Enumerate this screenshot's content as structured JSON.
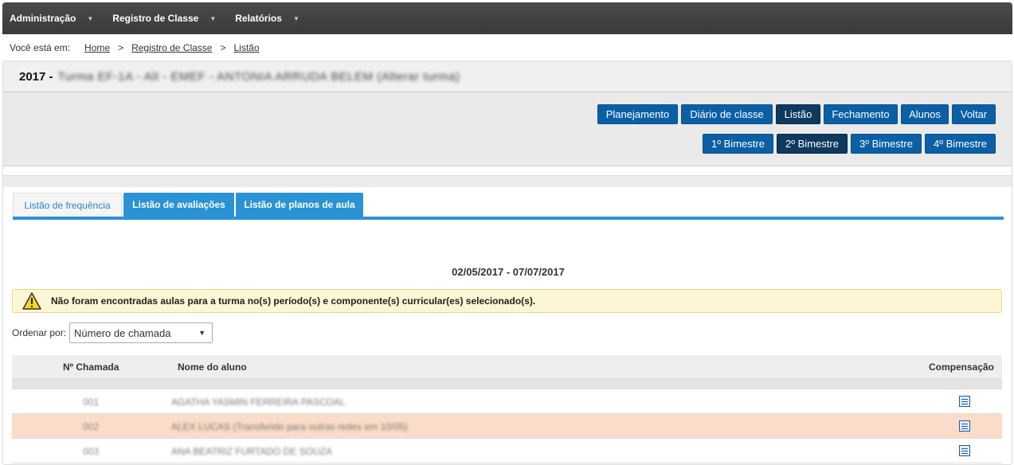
{
  "nav": {
    "items": [
      {
        "label": "Administração"
      },
      {
        "label": "Registro de Classe"
      },
      {
        "label": "Relatórios"
      }
    ]
  },
  "breadcrumb": {
    "prefix": "Você está em:",
    "items": [
      "Home",
      "Registro de Classe",
      "Listão"
    ],
    "separator": ">"
  },
  "header": {
    "year": "2017 -",
    "class_name": "Turma EF-1A - Alt - EMEF - ANTONIA ARRUDA BELEM (Alterar turma)"
  },
  "toolbar": {
    "buttons": [
      "Planejamento",
      "Diário de classe",
      "Listão",
      "Fechamento",
      "Alunos",
      "Voltar"
    ],
    "active_button": "Listão",
    "bimesters": [
      "1º Bimestre",
      "2º Bimestre",
      "3º Bimestre",
      "4º Bimestre"
    ],
    "active_bimester": "2º Bimestre"
  },
  "tabs": [
    "Listão de frequência",
    "Listão de avaliações",
    "Listão de planos de aula"
  ],
  "date_range": "02/05/2017 - 07/07/2017",
  "alert": {
    "icon": "warning-icon",
    "text": "Não foram encontradas aulas para a turma no(s) período(s) e componente(s) curricular(es) selecionado(s)."
  },
  "sort": {
    "label": "Ordenar por:",
    "selected": "Número de chamada",
    "arrow": "▼"
  },
  "table": {
    "headers": {
      "number": "Nº Chamada",
      "name": "Nome do aluno",
      "comp": "Compensação"
    },
    "rows": [
      {
        "number": "001",
        "name": "AGATHA YASMIN FERREIRA PASCOAL"
      },
      {
        "number": "002",
        "name": "ALEX LUCAS (Transferido para outras redes em 10/05)"
      },
      {
        "number": "003",
        "name": "ANA BEATRIZ FURTADO DE SOUZA"
      }
    ]
  },
  "colors": {
    "nav_bg": "#3f3f3f",
    "button_blue": "#0b5fa5",
    "active_dark": "#0d3a5e",
    "tab_blue": "#2a93d5",
    "alert_bg": "#fcf6d4",
    "highlight_row": "#fbdcc8"
  }
}
